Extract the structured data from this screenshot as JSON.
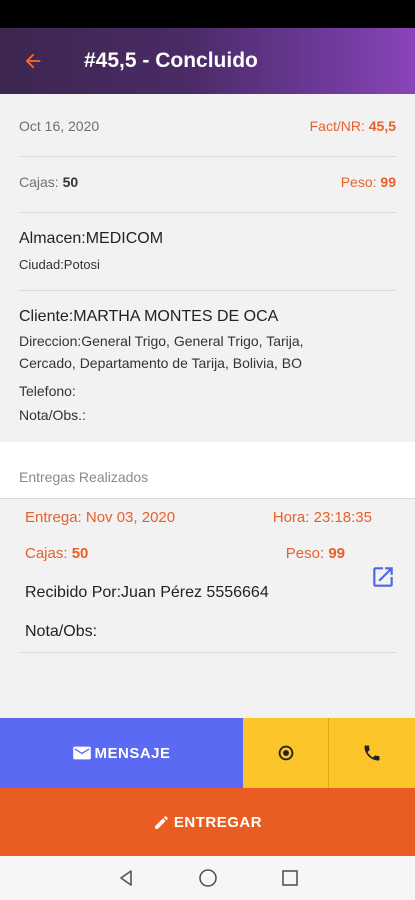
{
  "appbar": {
    "title": "#45,5 - Concluido",
    "back_icon": "arrow-left-icon"
  },
  "order": {
    "date": "Oct 16, 2020",
    "fact_label": "Fact/NR:",
    "fact_value": "45,5",
    "cajas_label": "Cajas:",
    "cajas_value": "50",
    "peso_label": "Peso:",
    "peso_value": "99",
    "almacen": "Almacen:MEDICOM",
    "ciudad": "Ciudad:Potosi",
    "cliente": "Cliente:MARTHA MONTES DE OCA",
    "direccion": "Direccion:General Trigo, General Trigo, Tarija, Cercado, Departamento de Tarija, Bolivia, BO",
    "telefono": "Telefono:",
    "nota": "Nota/Obs.:"
  },
  "deliveries": {
    "section_label": "Entregas Realizados",
    "items": [
      {
        "entrega": "Entrega: Nov 03, 2020",
        "hora": "Hora: 23:18:35",
        "cajas_label": "Cajas:",
        "cajas_value": "50",
        "peso_label": "Peso:",
        "peso_value": "99",
        "recibido": "Recibido Por:Juan Pérez 5556664",
        "nota": "Nota/Obs:"
      }
    ]
  },
  "actions": {
    "mensaje": "MENSAJE",
    "entregar": "ENTREGAR"
  },
  "colors": {
    "accent_orange": "#ea5d22",
    "message_blue": "#5b6af2",
    "action_yellow": "#fdc42a",
    "appbar_purple": "#4a2b66"
  }
}
